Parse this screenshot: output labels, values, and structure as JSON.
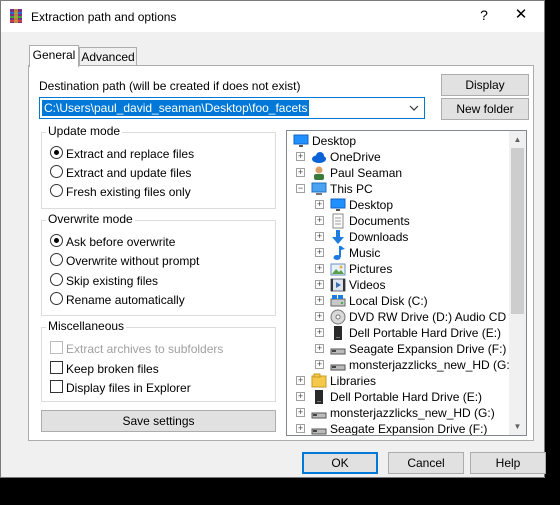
{
  "window": {
    "title": "Extraction path and options",
    "help_glyph": "?",
    "close_glyph": "✕"
  },
  "tabs": [
    {
      "label": "General",
      "active": true
    },
    {
      "label": "Advanced",
      "active": false
    }
  ],
  "destination": {
    "label": "Destination path (will be created if does not exist)",
    "value": "C:\\Users\\paul_david_seaman\\Desktop\\foo_facets"
  },
  "buttons": {
    "display": "Display",
    "new_folder": "New folder",
    "save_settings": "Save settings",
    "ok": "OK",
    "cancel": "Cancel",
    "help": "Help"
  },
  "update_mode": {
    "title": "Update mode",
    "options": [
      {
        "label": "Extract and replace files",
        "selected": true
      },
      {
        "label": "Extract and update files",
        "selected": false
      },
      {
        "label": "Fresh existing files only",
        "selected": false
      }
    ]
  },
  "overwrite_mode": {
    "title": "Overwrite mode",
    "options": [
      {
        "label": "Ask before overwrite",
        "selected": true
      },
      {
        "label": "Overwrite without prompt",
        "selected": false
      },
      {
        "label": "Skip existing files",
        "selected": false
      },
      {
        "label": "Rename automatically",
        "selected": false
      }
    ]
  },
  "miscellaneous": {
    "title": "Miscellaneous",
    "options": [
      {
        "label": "Extract archives to subfolders",
        "checked": false,
        "disabled": true
      },
      {
        "label": "Keep broken files",
        "checked": false,
        "disabled": false
      },
      {
        "label": "Display files in Explorer",
        "checked": false,
        "disabled": false
      }
    ]
  },
  "tree": {
    "items": [
      {
        "label": "Desktop",
        "icon": "desktop-icon"
      },
      {
        "label": "OneDrive",
        "icon": "cloud-icon"
      },
      {
        "label": "Paul Seaman",
        "icon": "user-icon"
      },
      {
        "label": "This PC",
        "icon": "computer-icon"
      },
      {
        "label": "Desktop",
        "icon": "desktop-icon"
      },
      {
        "label": "Documents",
        "icon": "documents-icon"
      },
      {
        "label": "Downloads",
        "icon": "download-icon"
      },
      {
        "label": "Music",
        "icon": "music-icon"
      },
      {
        "label": "Pictures",
        "icon": "pictures-icon"
      },
      {
        "label": "Videos",
        "icon": "video-icon"
      },
      {
        "label": "Local Disk (C:)",
        "icon": "drive-icon"
      },
      {
        "label": "DVD RW Drive (D:) Audio CD",
        "icon": "cd-icon"
      },
      {
        "label": "Dell Portable Hard Drive (E:)",
        "icon": "hard-drive-icon"
      },
      {
        "label": "Seagate Expansion Drive (F:)",
        "icon": "external-drive-icon"
      },
      {
        "label": "monsterjazzlicks_new_HD (G:)",
        "icon": "external-drive-icon"
      },
      {
        "label": "Libraries",
        "icon": "libraries-icon"
      },
      {
        "label": "Dell Portable Hard Drive (E:)",
        "icon": "hard-drive-icon"
      },
      {
        "label": "monsterjazzlicks_new_HD (G:)",
        "icon": "external-drive-icon"
      },
      {
        "label": "Seagate Expansion Drive (F:)",
        "icon": "external-drive-icon"
      }
    ]
  },
  "colors": {
    "accent": "#0078d7",
    "window_bg": "#f0f0f0",
    "panel_bg": "#ffffff"
  }
}
